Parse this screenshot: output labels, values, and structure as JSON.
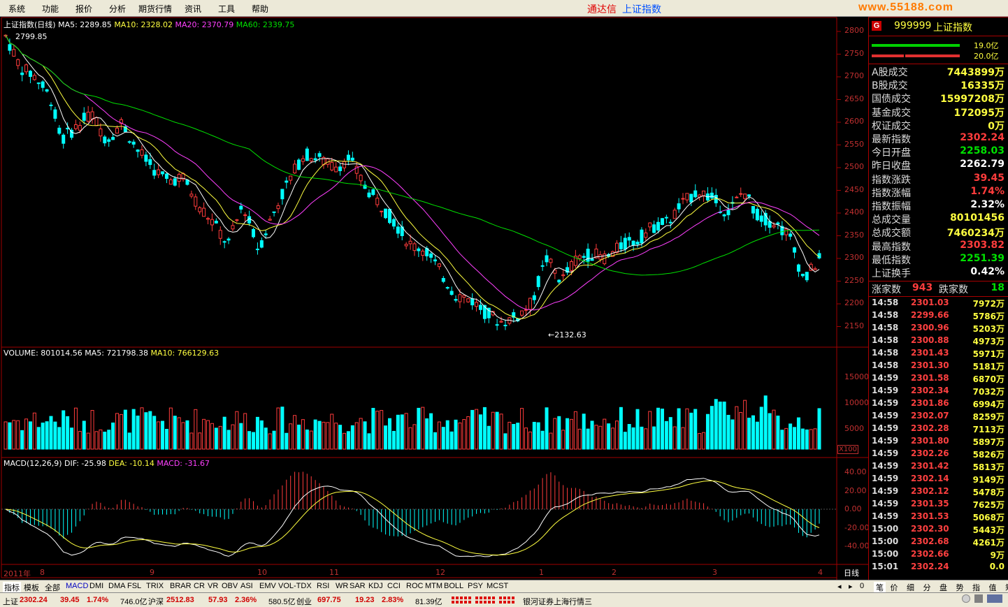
{
  "menu": {
    "items": [
      "系统",
      "功能",
      "报价",
      "分析",
      "期货行情",
      "资讯",
      "工具",
      "帮助"
    ],
    "brand_left": "通达信",
    "brand_right": "上证指数",
    "site": "www.55188.com"
  },
  "kline": {
    "title": "上证指数(日线)",
    "ma5": "MA5: 2289.85",
    "ma10": "MA10: 2328.02",
    "ma20": "MA20: 2370.79",
    "ma60": "MA60: 2339.75",
    "high_mark": "2799.85",
    "low_mark": "←2132.63",
    "y_ticks": [
      "2800",
      "2750",
      "2700",
      "2650",
      "2600",
      "2550",
      "2500",
      "2450",
      "2400",
      "2350",
      "2300",
      "2250",
      "2200",
      "2150"
    ]
  },
  "volume": {
    "title": "VOLUME: 801014.56",
    "ma5": "MA5: 721798.38",
    "ma10": "MA10: 766129.63",
    "y_ticks": [
      "15000",
      "10000",
      "5000"
    ],
    "unit": "X100"
  },
  "macd": {
    "title": "MACD(12,26,9)",
    "dif": "DIF: -25.98",
    "dea": "DEA: -10.14",
    "macd": "MACD: -31.67",
    "y_ticks": [
      "40.00",
      "20.00",
      "0.00",
      "-20.00",
      "-40.00"
    ]
  },
  "x_axis": {
    "labels": [
      "2011年",
      "8",
      "9",
      "10",
      "11",
      "12",
      "1",
      "2",
      "3",
      "4"
    ],
    "period": "日线"
  },
  "quote": {
    "code": "999999",
    "name": "上证指数",
    "bar1_val": "19.0亿",
    "bar2_val": "20.0亿",
    "rows": [
      {
        "label": "A股成交",
        "value": "7443899万",
        "color": "yellow"
      },
      {
        "label": "B股成交",
        "value": "16335万",
        "color": "yellow"
      },
      {
        "label": "国债成交",
        "value": "15997208万",
        "color": "yellow"
      },
      {
        "label": "基金成交",
        "value": "172095万",
        "color": "yellow"
      },
      {
        "label": "权证成交",
        "value": "0万",
        "color": "yellow"
      },
      {
        "label": "最新指数",
        "value": "2302.24",
        "color": "red"
      },
      {
        "label": "今日开盘",
        "value": "2258.03",
        "color": "green"
      },
      {
        "label": "昨日收盘",
        "value": "2262.79",
        "color": "white"
      },
      {
        "label": "指数涨跌",
        "value": "39.45",
        "color": "red"
      },
      {
        "label": "指数涨幅",
        "value": "1.74%",
        "color": "red"
      },
      {
        "label": "指数振幅",
        "value": "2.32%",
        "color": "white"
      },
      {
        "label": "总成交量",
        "value": "80101456",
        "color": "yellow"
      },
      {
        "label": "总成交额",
        "value": "7460234万",
        "color": "yellow"
      },
      {
        "label": "最高指数",
        "value": "2303.82",
        "color": "red"
      },
      {
        "label": "最低指数",
        "value": "2251.39",
        "color": "green"
      },
      {
        "label": "上证换手",
        "value": "0.42%",
        "color": "white"
      }
    ],
    "up_label": "涨家数",
    "up_count": "943",
    "down_label": "跌家数",
    "down_count": "18"
  },
  "ticks": [
    {
      "t": "14:58",
      "p": "2301.03",
      "v": "7972万"
    },
    {
      "t": "14:58",
      "p": "2299.66",
      "v": "5786万"
    },
    {
      "t": "14:58",
      "p": "2300.96",
      "v": "5203万"
    },
    {
      "t": "14:58",
      "p": "2300.88",
      "v": "4973万"
    },
    {
      "t": "14:58",
      "p": "2301.43",
      "v": "5971万"
    },
    {
      "t": "14:58",
      "p": "2301.30",
      "v": "5181万"
    },
    {
      "t": "14:59",
      "p": "2301.58",
      "v": "6870万"
    },
    {
      "t": "14:59",
      "p": "2302.34",
      "v": "7032万"
    },
    {
      "t": "14:59",
      "p": "2301.86",
      "v": "6994万"
    },
    {
      "t": "14:59",
      "p": "2302.07",
      "v": "8259万"
    },
    {
      "t": "14:59",
      "p": "2302.28",
      "v": "7113万"
    },
    {
      "t": "14:59",
      "p": "2301.80",
      "v": "5897万"
    },
    {
      "t": "14:59",
      "p": "2302.26",
      "v": "5826万"
    },
    {
      "t": "14:59",
      "p": "2301.42",
      "v": "5813万"
    },
    {
      "t": "14:59",
      "p": "2302.14",
      "v": "9149万"
    },
    {
      "t": "14:59",
      "p": "2302.12",
      "v": "5478万"
    },
    {
      "t": "14:59",
      "p": "2301.35",
      "v": "7625万"
    },
    {
      "t": "14:59",
      "p": "2301.53",
      "v": "5068万"
    },
    {
      "t": "15:00",
      "p": "2302.30",
      "v": "5443万"
    },
    {
      "t": "15:00",
      "p": "2302.68",
      "v": "4261万"
    },
    {
      "t": "15:00",
      "p": "2302.66",
      "v": "9万"
    },
    {
      "t": "15:01",
      "p": "2302.24",
      "v": "0.0"
    }
  ],
  "indicator_tabs": [
    "指标",
    "模板",
    "全部",
    "MACD",
    "DMI",
    "DMA",
    "FSL",
    "TRIX",
    "BRAR",
    "CR",
    "VR",
    "OBV",
    "ASI",
    "EMV",
    "VOL-TDX",
    "RSI",
    "WR",
    "SAR",
    "KDJ",
    "CCI",
    "ROC",
    "MTM",
    "BOLL",
    "PSY",
    "MCST"
  ],
  "right_tabs": [
    "笔",
    "价",
    "细",
    "分",
    "盘",
    "势",
    "指",
    "值",
    "筹"
  ],
  "status": {
    "sh_label": "上证",
    "sh_val": "2302.24",
    "sh_chg": "39.45",
    "sh_pct": "1.74%",
    "sh_amt": "746.0亿",
    "hs_label": "沪深",
    "hs_val": "2512.83",
    "hs_chg": "57.93",
    "hs_pct": "2.36%",
    "hs_amt": "580.5亿",
    "cy_label": "创业",
    "cy_val": "697.75",
    "cy_chg": "19.23",
    "cy_pct": "2.83%",
    "cy_amt": "81.39亿",
    "server": "银河证券上海行情三"
  }
}
